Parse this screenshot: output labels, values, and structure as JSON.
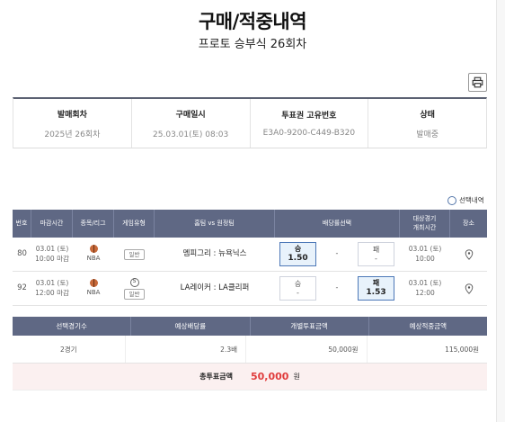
{
  "header": {
    "title": "구매/적중내역",
    "subtitle": "프로토 승부식 26회차"
  },
  "toolbar": {
    "print_icon": "printer-icon"
  },
  "info": {
    "round_label": "발매회차",
    "round_value": "2025년 26회차",
    "date_label": "구매일시",
    "date_value": "25.03.01(토) 08:03",
    "ticket_label": "투표권 고유번호",
    "ticket_value": "E3A0-9200-C449-B320",
    "status_label": "상태",
    "status_value": "발매중"
  },
  "filter": {
    "select_label": "선택내역"
  },
  "bet_table": {
    "headers": {
      "no": "번호",
      "deadline": "마감시간",
      "sport": "종목/리그",
      "type": "게임유형",
      "teams": "홈팀 vs 원정팀",
      "odds": "배당률선택",
      "result_time_1": "대상경기",
      "result_time_2": "개최시간",
      "location": "장소"
    },
    "rows": [
      {
        "no": "80",
        "deadline_date": "03.01 (토)",
        "deadline_time": "10:00 마감",
        "league": "NBA",
        "type": "일반",
        "teams": "멤피그리 : 뉴욕닉스",
        "odd1_label": "승",
        "odd1_value": "1.50",
        "mid": "-",
        "odd2_label": "패",
        "odd2_value": "-",
        "game_date": "03.01 (토)",
        "game_time": "10:00"
      },
      {
        "no": "92",
        "deadline_date": "03.01 (토)",
        "deadline_time": "12:00 마감",
        "league": "NBA",
        "type_icon": "S",
        "type": "일반",
        "teams": "LA레이커 : LA클리퍼",
        "odd1_label": "승",
        "odd1_value": "-",
        "mid": "-",
        "odd2_label": "패",
        "odd2_value": "1.53",
        "game_date": "03.01 (토)",
        "game_time": "12:00"
      }
    ]
  },
  "summary": {
    "headers": [
      "선택경기수",
      "예상배당률",
      "개별투표금액",
      "예상적중금액"
    ],
    "values": [
      "2경기",
      "2.3배",
      "50,000원",
      "115,000원"
    ],
    "total_label": "총투표금액",
    "total_amount": "50,000",
    "total_unit": "원"
  }
}
